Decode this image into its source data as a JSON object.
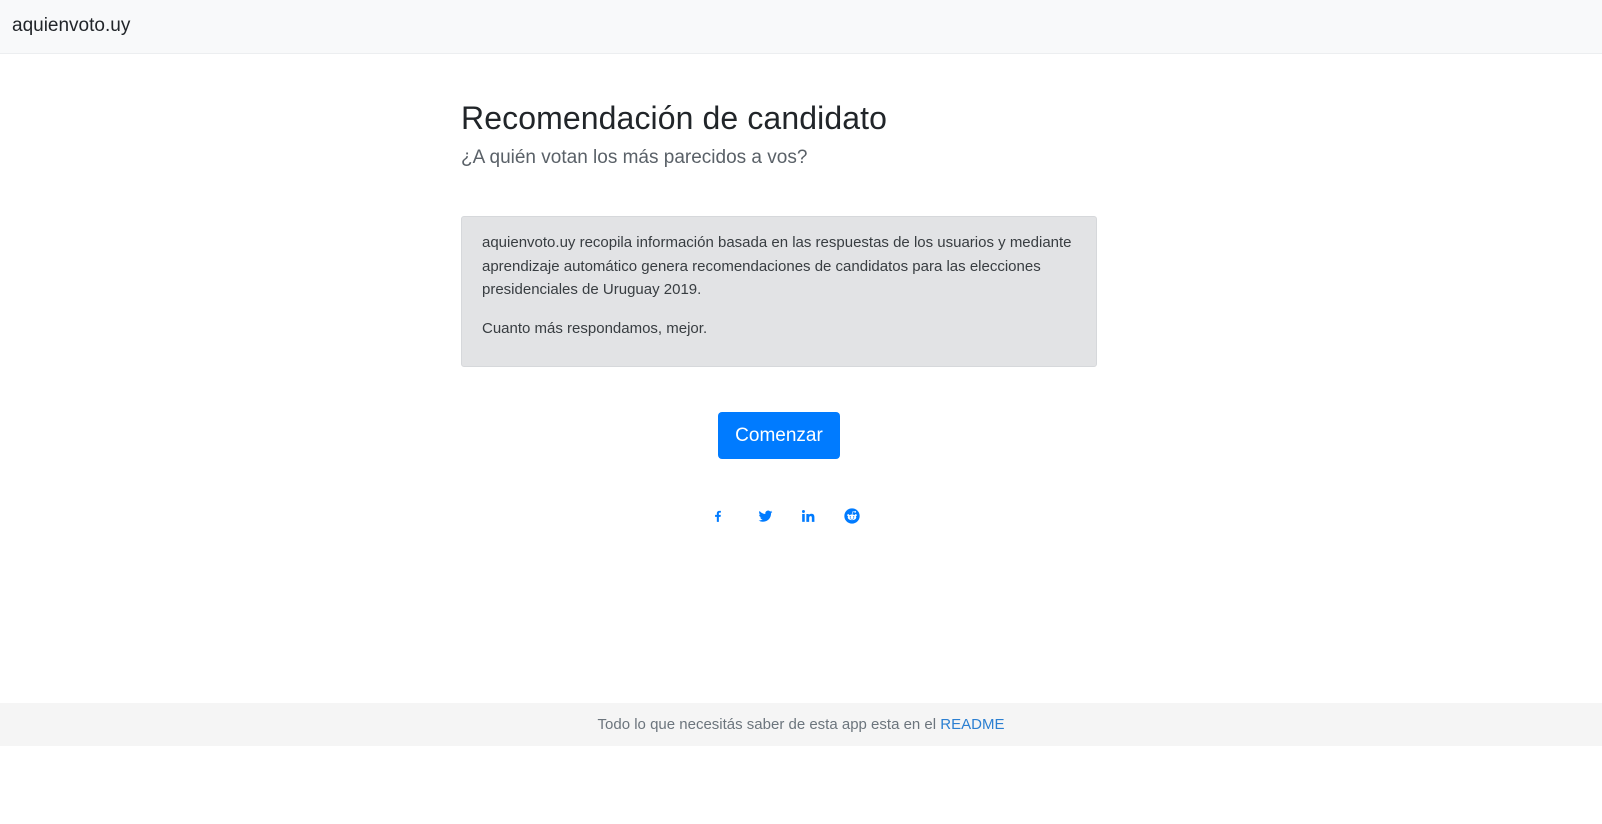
{
  "navbar": {
    "brand": "aquienvoto.uy"
  },
  "main": {
    "title": "Recomendación de candidato",
    "subtitle": "¿A quién votan los más parecidos a vos?",
    "info": {
      "paragraph1": "aquienvoto.uy recopila información basada en las respuestas de los usuarios y mediante aprendizaje automático genera recomendaciones de candidatos para las elecciones presidenciales de Uruguay 2019.",
      "paragraph2": "Cuanto más respondamos, mejor."
    },
    "start_button": "Comenzar"
  },
  "share": {
    "icons": [
      "facebook-icon",
      "twitter-icon",
      "linkedin-icon",
      "reddit-icon"
    ],
    "color": "#007bff"
  },
  "footer": {
    "text": "Todo lo que necesitás saber de esta app esta en el ",
    "link": "README"
  },
  "colors": {
    "primary": "#007bff",
    "navbar_bg": "#f8f9fa",
    "info_bg": "#e2e3e5",
    "footer_bg": "#f5f5f5"
  }
}
